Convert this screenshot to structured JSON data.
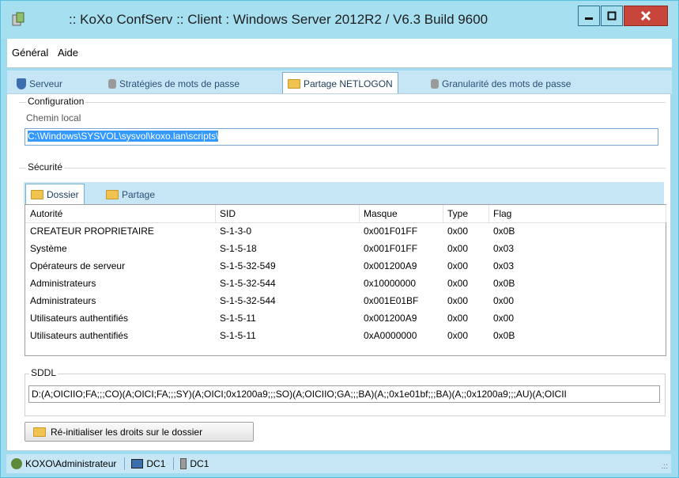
{
  "window": {
    "title": ":: KoXo ConfServ :: Client : Windows Server 2012R2 / V6.3 Build 9600"
  },
  "menu": [
    {
      "label": "Général"
    },
    {
      "label": "Aide"
    }
  ],
  "tabs": [
    {
      "label": "Serveur",
      "icon": "shield-icon"
    },
    {
      "label": "Stratégies de mots de passe",
      "icon": "lock-icon"
    },
    {
      "label": "Partage NETLOGON",
      "icon": "folder-icon",
      "active": true
    },
    {
      "label": "Granularité des mots de passe",
      "icon": "lock-icon"
    }
  ],
  "configuration": {
    "title": "Configuration",
    "chemin_label": "Chemin local",
    "chemin_value": "C:\\Windows\\SYSVOL\\sysvol\\koxo.lan\\scripts\\"
  },
  "securite": {
    "title": "Sécurité",
    "tabs": [
      {
        "label": "Dossier",
        "active": true
      },
      {
        "label": "Partage"
      }
    ]
  },
  "acl": {
    "columns": [
      "Autorité",
      "SID",
      "Masque",
      "Type",
      "Flag"
    ],
    "rows": [
      [
        "CREATEUR PROPRIETAIRE",
        "S-1-3-0",
        "0x001F01FF",
        "0x00",
        "0x0B"
      ],
      [
        "Système",
        "S-1-5-18",
        "0x001F01FF",
        "0x00",
        "0x03"
      ],
      [
        "Opérateurs de serveur",
        "S-1-5-32-549",
        "0x001200A9",
        "0x00",
        "0x03"
      ],
      [
        "Administrateurs",
        "S-1-5-32-544",
        "0x10000000",
        "0x00",
        "0x0B"
      ],
      [
        "Administrateurs",
        "S-1-5-32-544",
        "0x001E01BF",
        "0x00",
        "0x00"
      ],
      [
        "Utilisateurs authentifiés",
        "S-1-5-11",
        "0x001200A9",
        "0x00",
        "0x00"
      ],
      [
        "Utilisateurs authentifiés",
        "S-1-5-11",
        "0xA0000000",
        "0x00",
        "0x0B"
      ]
    ]
  },
  "sddl": {
    "title": "SDDL",
    "value": "D:(A;OICIIO;FA;;;CO)(A;OICI;FA;;;SY)(A;OICI;0x1200a9;;;SO)(A;OICIIO;GA;;;BA)(A;;0x1e01bf;;;BA)(A;;0x1200a9;;;AU)(A;OICII"
  },
  "reset_button": "Ré-initialiser les droits sur le dossier",
  "status": {
    "user": "KOXO\\Administrateur",
    "dc1": "DC1",
    "dc2": "DC1"
  },
  "colors": {
    "titlebar": "#a6dff0",
    "close": "#c7453a",
    "accent": "#3399ff"
  }
}
